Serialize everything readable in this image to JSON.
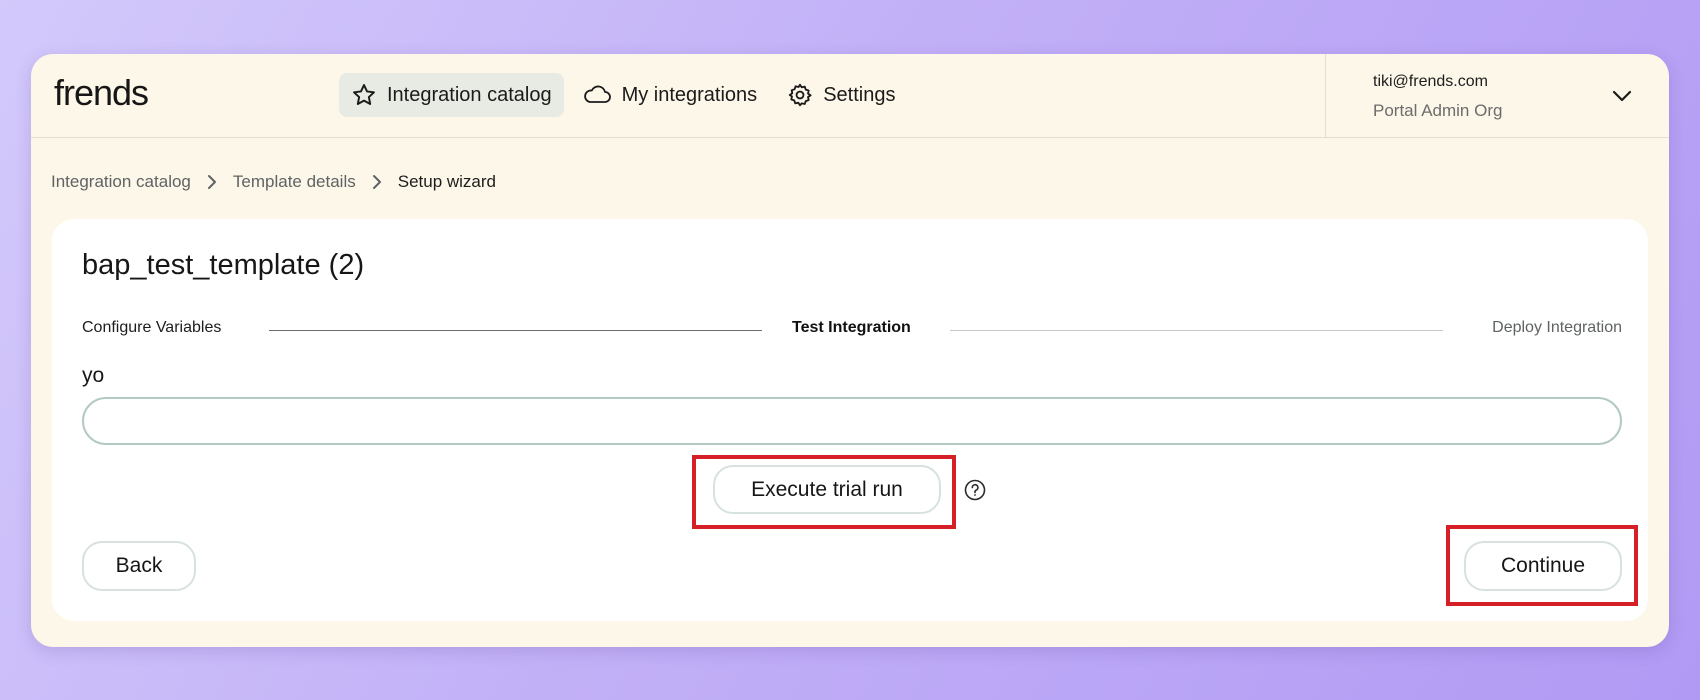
{
  "app": {
    "logo_text": "frends"
  },
  "nav": {
    "items": [
      {
        "label": "Integration catalog",
        "icon": "star-icon",
        "active": true
      },
      {
        "label": "My integrations",
        "icon": "cloud-icon",
        "active": false
      },
      {
        "label": "Settings",
        "icon": "gear-icon",
        "active": false
      }
    ]
  },
  "user": {
    "email": "tiki@frends.com",
    "org": "Portal Admin Org"
  },
  "breadcrumb": {
    "items": [
      "Integration catalog",
      "Template details",
      "Setup wizard"
    ]
  },
  "wizard": {
    "title": "bap_test_template (2)",
    "steps": [
      "Configure Variables",
      "Test Integration",
      "Deploy Integration"
    ],
    "current_step": "Test Integration",
    "field_label": "yo",
    "field_value": "",
    "execute_label": "Execute trial run",
    "back_label": "Back",
    "continue_label": "Continue"
  },
  "colors": {
    "background_start": "#d3c9fb",
    "background_end": "#b19af4",
    "window": "#fdf7e9",
    "card": "#ffffff",
    "active_nav": "#e8ebe3",
    "highlight": "#d62027"
  }
}
